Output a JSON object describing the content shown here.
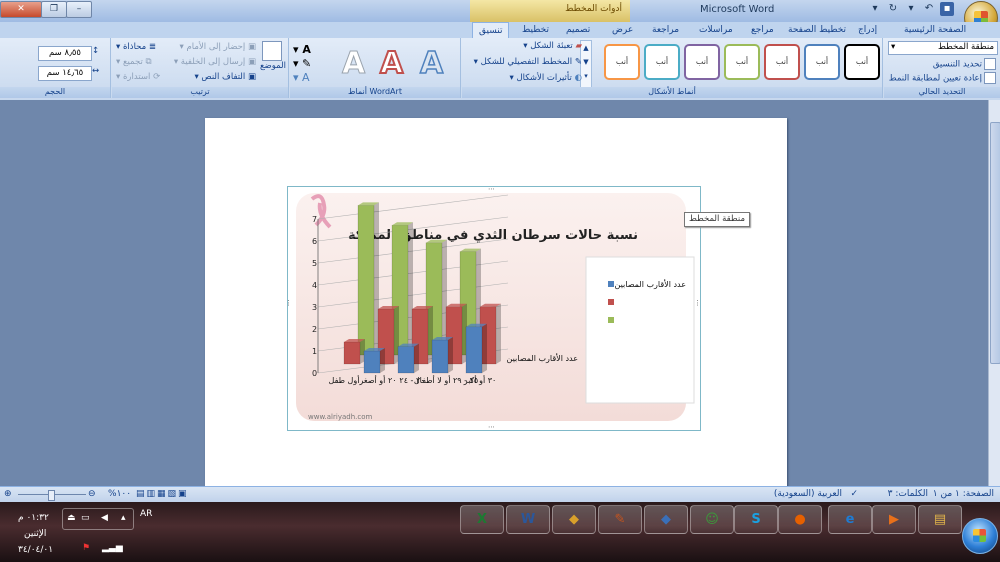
{
  "window": {
    "title": "Microsoft Word",
    "contextual_tools_label": "أدوات المخطط",
    "buttons": {
      "close": "✕",
      "maximize": "❐",
      "minimize": "–"
    }
  },
  "tabs": [
    {
      "label": "الصفحة الرئيسية"
    },
    {
      "label": "إدراج"
    },
    {
      "label": "تخطيط الصفحة"
    },
    {
      "label": "مراجع"
    },
    {
      "label": "مراسلات"
    },
    {
      "label": "مراجعة"
    },
    {
      "label": "عرض"
    },
    {
      "label": "تصميم"
    },
    {
      "label": "تخطيط"
    },
    {
      "label": "تنسيق",
      "active": true
    }
  ],
  "ribbon": {
    "current_selection": {
      "label": "التحديد الحالي",
      "dropdown_value": "منطقة المخطط",
      "format_selection": "تحديد التنسيق",
      "reset_style": "إعادة تعيين لمطابقة النمط"
    },
    "shape_styles": {
      "label": "أنماط الأشكال",
      "swatch_text": "أنب",
      "swatch_colors": [
        "#000000",
        "#4f81bd",
        "#c0504d",
        "#9bbb59",
        "#8064a2",
        "#4bacc6",
        "#f79646"
      ],
      "fill": "تعبئة الشكل",
      "outline": "المخطط التفصيلي للشكل",
      "effects": "تأثيرات الأشكال"
    },
    "wordart": {
      "label": "أنماط WordArt",
      "letter": "A"
    },
    "arrange": {
      "label": "ترتيب",
      "position": "الموضع",
      "bring_forward": "إحضار إلى الأمام",
      "send_backward": "إرسال إلى الخلفية",
      "text_wrap": "التفاف النص",
      "align": "محاذاة",
      "group": "تجميع",
      "rotate": "استدارة"
    },
    "size": {
      "label": "الحجم",
      "height": "٨٫٥٥ سم",
      "width": "١٤٫٦٥ سم"
    }
  },
  "chart": {
    "title": "نسبة حالات سرطان الثدي في مناطق المملكة",
    "website": "www.alriyadh.com",
    "tooltip": "منطقة المخطط",
    "legend": [
      {
        "label": "عدد الأقارب المصابين",
        "color": "#4f81bd"
      },
      {
        "label": "",
        "color": "#c0504d"
      },
      {
        "label": "",
        "color": "#9bbb59"
      }
    ]
  },
  "chart_data": {
    "type": "bar",
    "title": "نسبة حالات سرطان الثدي في مناطق المملكة",
    "categories": [
      "أول طفل",
      "٢٠ أو أصغر",
      "٢٠ - ٢٤",
      "٢٥ - ٢٩ أو لا أطفال",
      "٣٠ أو أكبر"
    ],
    "series": [
      {
        "name": "عدد الأقارب المصابين",
        "values": [
          0,
          1,
          1.2,
          1.5,
          2.1
        ]
      },
      {
        "values": [
          1,
          2.5,
          2.5,
          2.6,
          2.6
        ]
      },
      {
        "values": [
          6.8,
          5.9,
          5.1,
          4.7,
          0
        ]
      }
    ],
    "depth_axis_label": "عدد الأقارب المصابين",
    "ylim": [
      0,
      7
    ],
    "yticks": [
      0,
      1,
      2,
      3,
      4,
      5,
      6,
      7
    ],
    "gridlines": true,
    "legend_position": "right"
  },
  "statusbar": {
    "page": "الصفحة: ١ من ١",
    "words": "الكلمات: ٣",
    "language": "العربية (السعودية)",
    "zoom": "%١٠٠"
  },
  "taskbar": {
    "time": "٠١:٣٢ م",
    "day": "الإثنين",
    "date": "٣٤/٠٤/٠١",
    "lang": "AR",
    "apps": [
      {
        "name": "excel",
        "glyph": "X",
        "color": "#1d7a32"
      },
      {
        "name": "word",
        "glyph": "W",
        "color": "#2b579a"
      },
      {
        "name": "security",
        "glyph": "◆",
        "color": "#d8a02b"
      },
      {
        "name": "paint",
        "glyph": "✎",
        "color": "#c4541e"
      },
      {
        "name": "shield",
        "glyph": "◆",
        "color": "#3a6fb8"
      },
      {
        "name": "messenger",
        "glyph": "☺",
        "color": "#3a9d3a"
      },
      {
        "name": "skype",
        "glyph": "S",
        "color": "#1aa1e2"
      },
      {
        "name": "firefox",
        "glyph": "●",
        "color": "#e66000"
      },
      {
        "name": "ie",
        "glyph": "e",
        "color": "#1e7cd3"
      },
      {
        "name": "media",
        "glyph": "▶",
        "color": "#e8701a"
      },
      {
        "name": "explorer",
        "glyph": "▤",
        "color": "#e2b54a"
      }
    ]
  }
}
